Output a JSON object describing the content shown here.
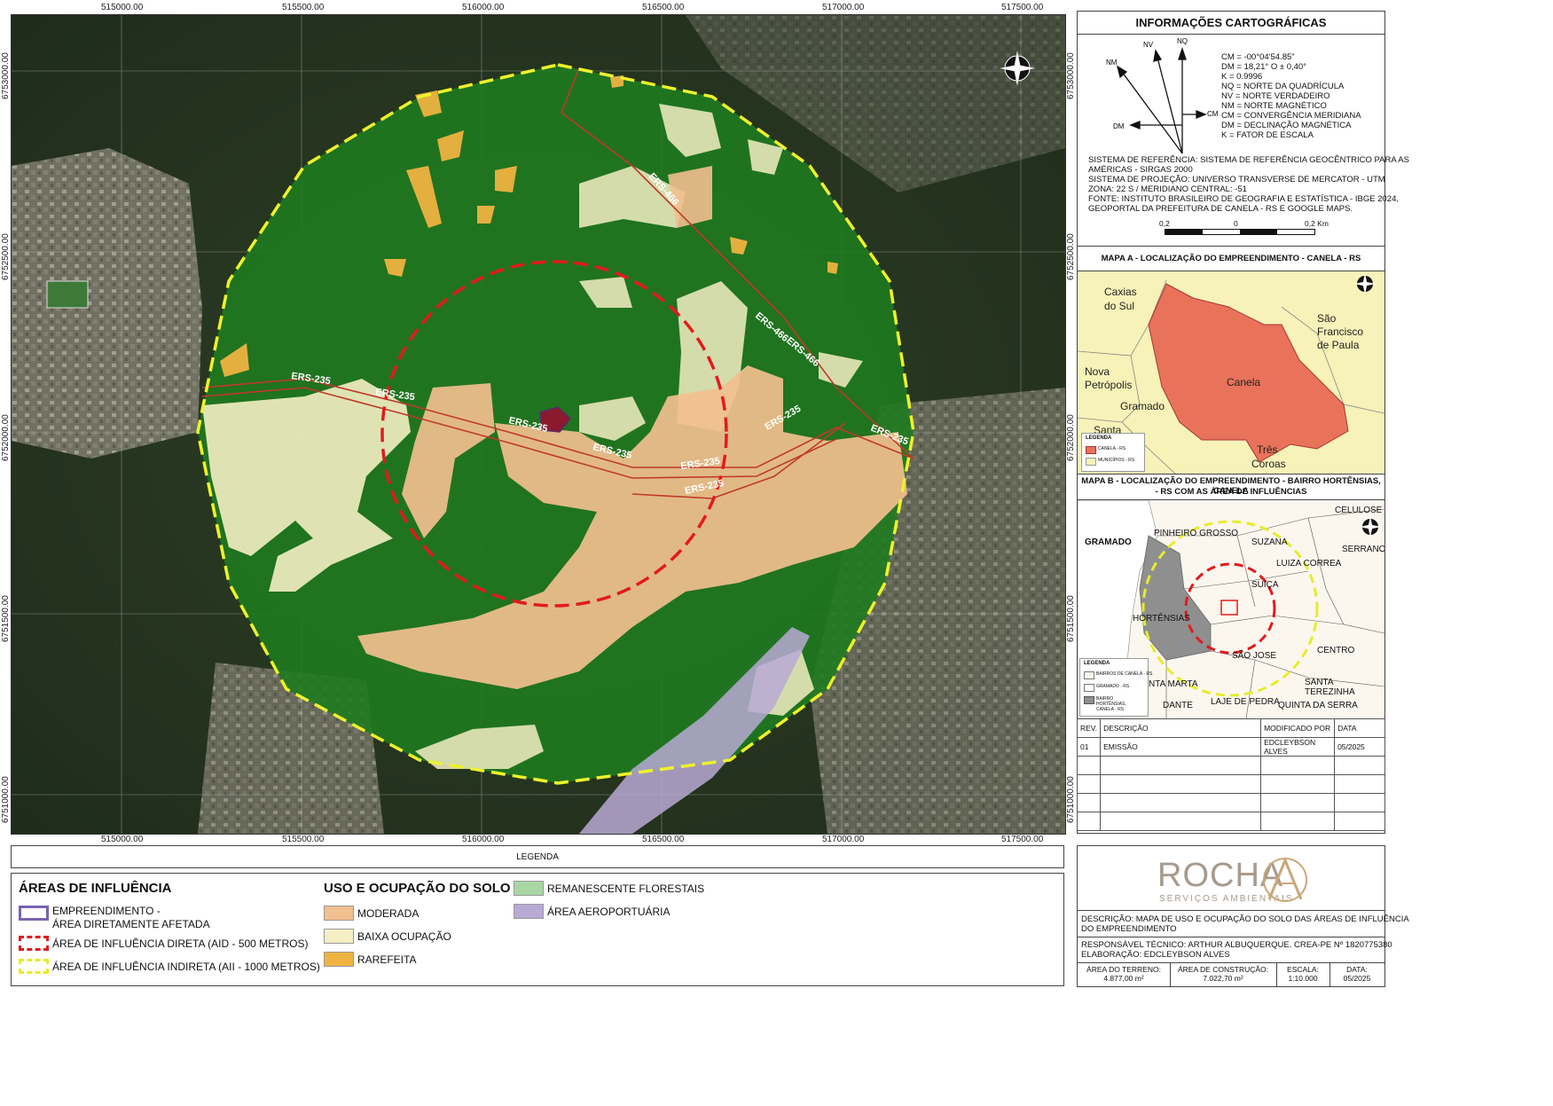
{
  "map": {
    "x_coords": [
      "515000.00",
      "515500.00",
      "516000.00",
      "516500.00",
      "517000.00",
      "517500.00"
    ],
    "y_coords": [
      "6753000.00",
      "6752500.00",
      "6752000.00",
      "6751500.00",
      "6751000.00"
    ],
    "road_labels": [
      "ERS-466",
      "ERS-466",
      "ERS-466",
      "ERS-235",
      "ERS-235",
      "ERS-235",
      "ERS-235",
      "ERS-235",
      "ERS-235",
      "ERS-235",
      "ERS-235"
    ]
  },
  "info": {
    "title": "INFORMAÇÕES CARTOGRÁFICAS",
    "north": {
      "nm": "NM",
      "nv": "NV",
      "nq": "NQ",
      "dm": "DM",
      "cm": "CM",
      "lines": [
        "CM = -00°04'54.85\"",
        "DM = 18,21° O ± 0,40°",
        "K = 0.9996",
        "NQ = NORTE DA QUADRÍCULA",
        "NV = NORTE VERDADEIRO",
        "NM = NORTE MAGNÉTICO",
        "CM = CONVERGÊNCIA MERIDIANA",
        "DM = DECLINAÇÃO MAGNÉTICA",
        "K = FATOR DE ESCALA"
      ]
    },
    "reference_lines": [
      "SISTEMA DE REFERÊNCIA: SISTEMA DE REFERÊNCIA GEOCÊNTRICO PARA AS",
      "AMÉRICAS - SIRGAS 2000",
      "SISTEMA DE PROJEÇÃO: UNIVERSO TRANSVERSE DE MERCATOR - UTM",
      "ZONA: 22 S / MERIDIANO CENTRAL: -51",
      "FONTE: INSTITUTO BRASILEIRO DE GEOGRAFIA E ESTATÍSTICA - IBGE 2024,",
      "GEOPORTAL DA PREFEITURA DE CANELA - RS E GOOGLE MAPS."
    ],
    "scalebar": {
      "left": "0,2",
      "mid": "0",
      "right": "0,2 Km"
    }
  },
  "map_a": {
    "title": "MAPA A - LOCALIZAÇÃO DO EMPREENDIMENTO - CANELA - RS",
    "places": [
      "Caxias",
      "do Sul",
      "São",
      "Francisco",
      "de Paula",
      "Nova",
      "Petrópolis",
      "Canela",
      "Gramado",
      "Santa",
      "Três",
      "Coroas"
    ],
    "legend_title": "LEGENDA",
    "legend_items": [
      "CANELA - RS",
      "MUNICÍPIOS - RS"
    ],
    "colors": {
      "canela": "#e8735a",
      "municipios": "#f6f2b8"
    }
  },
  "map_b": {
    "title_lines": [
      "MAPA B - LOCALIZAÇÃO DO EMPREENDIMENTO - BAIRRO HORTÊNSIAS, CANELA",
      "- RS COM AS ÁREA DE INFLUÊNCIAS"
    ],
    "places": [
      "CELULOSE",
      "GRAMADO",
      "PINHEIRO GROSSO",
      "SUZANA",
      "SERRANO",
      "LUIZA CORREA",
      "SUIÇA",
      "HORTÊNSIAS",
      "CENTRO",
      "SÃO JOSE",
      "SANTA TEREZINHA",
      "NTA MARTA",
      "DANTE",
      "LAJE DE PEDRA",
      "QUINTA DA SERRA"
    ],
    "legend_title": "LEGENDA",
    "legend_items": [
      "BAIRROS DE CANELA - RS",
      "GRAMADO - RS",
      "BAIRRO HORTÊNSIAS, CANELA - RS"
    ]
  },
  "revision": {
    "headers": [
      "REV.",
      "DESCRIÇÃO",
      "MODIFICADO POR",
      "DATA"
    ],
    "rows": [
      [
        "01",
        "EMISSÃO",
        "EDCLEYBSON ALVES",
        "05/2025"
      ]
    ]
  },
  "legend": {
    "caption": "LEGENDA",
    "areas_title": "ÁREAS DE INFLUÊNCIA",
    "areas": [
      "EMPREENDIMENTO -",
      "ÁREA DIRETAMENTE AFETADA",
      "ÁREA DE INFLUÊNCIA DIRETA (AID - 500 METROS)",
      "ÁREA DE INFLUÊNCIA INDIRETA (AII - 1000 METROS)"
    ],
    "uso_title": "USO E OCUPAÇÃO DO SOLO",
    "uso": [
      "MODERADA",
      "BAIXA OCUPAÇÃO",
      "RAREFEITA"
    ],
    "other": [
      "REMANESCENTE FLORESTAIS",
      "ÁREA AEROPORTUÁRIA"
    ],
    "colors": {
      "empreendimento": "#7a63b0",
      "aid": "#d91f1f",
      "aii": "#e7ec2c",
      "moderada": "#f2bf8e",
      "baixa": "#f4efc4",
      "rarefeita": "#eeb341",
      "remanescente": "#a9d7a4",
      "aeroportuaria": "#b9a9d5"
    }
  },
  "company": {
    "name": "ROCHA",
    "tagline": "SERVIÇOS AMBIENTAIS"
  },
  "footer": {
    "descricao": [
      "DESCRIÇÃO: MAPA DE USO E OCUPAÇÃO DO SOLO DAS ÁREAS DE INFLUÊNCIA",
      "DO EMPREENDIMENTO"
    ],
    "responsavel": "RESPONSÁVEL TÉCNICO: ARTHUR ALBUQUERQUE. CREA-PE Nº 1820775380",
    "elaboracao": "ELABORAÇÃO: EDCLEYBSON ALVES",
    "area_terreno_label": "ÁREA DO TERRENO:",
    "area_terreno_value": "4.877,00 m²",
    "area_construcao_label": "ÁREA DE CONSTRUÇÃO:",
    "area_construcao_value": "7.022,70 m²",
    "escala_label": "ESCALA:",
    "escala_value": "1:10.000",
    "data_label": "DATA:",
    "data_value": "05/2025"
  }
}
